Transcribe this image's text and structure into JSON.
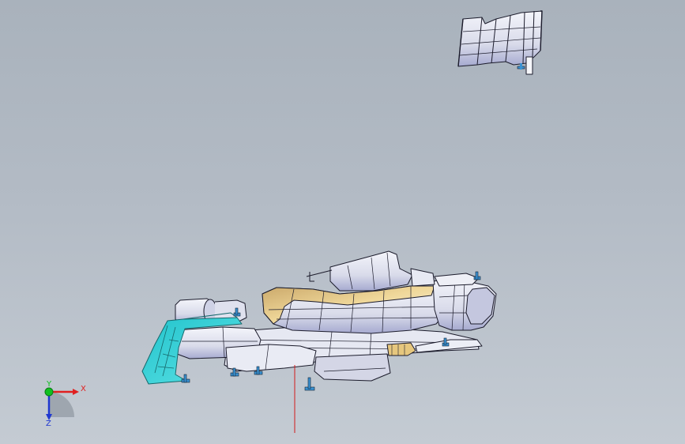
{
  "triad": {
    "x_label": "X",
    "y_label": "Y",
    "z_label": "Z",
    "x_color": "#e02020",
    "y_color": "#10c020",
    "z_color": "#2038d0"
  },
  "colors": {
    "background_top": "#a9b2bc",
    "background_bottom": "#c4cbd3",
    "part_fill": "#eceef5",
    "part_shade": "#a7abd2",
    "part_edge": "#1c1c2c",
    "highlight_gold": "#e4c57c",
    "bracket_cyan": "#33d3d8",
    "fastener_blue": "#3a92d2",
    "section_line": "#d21b1b"
  }
}
